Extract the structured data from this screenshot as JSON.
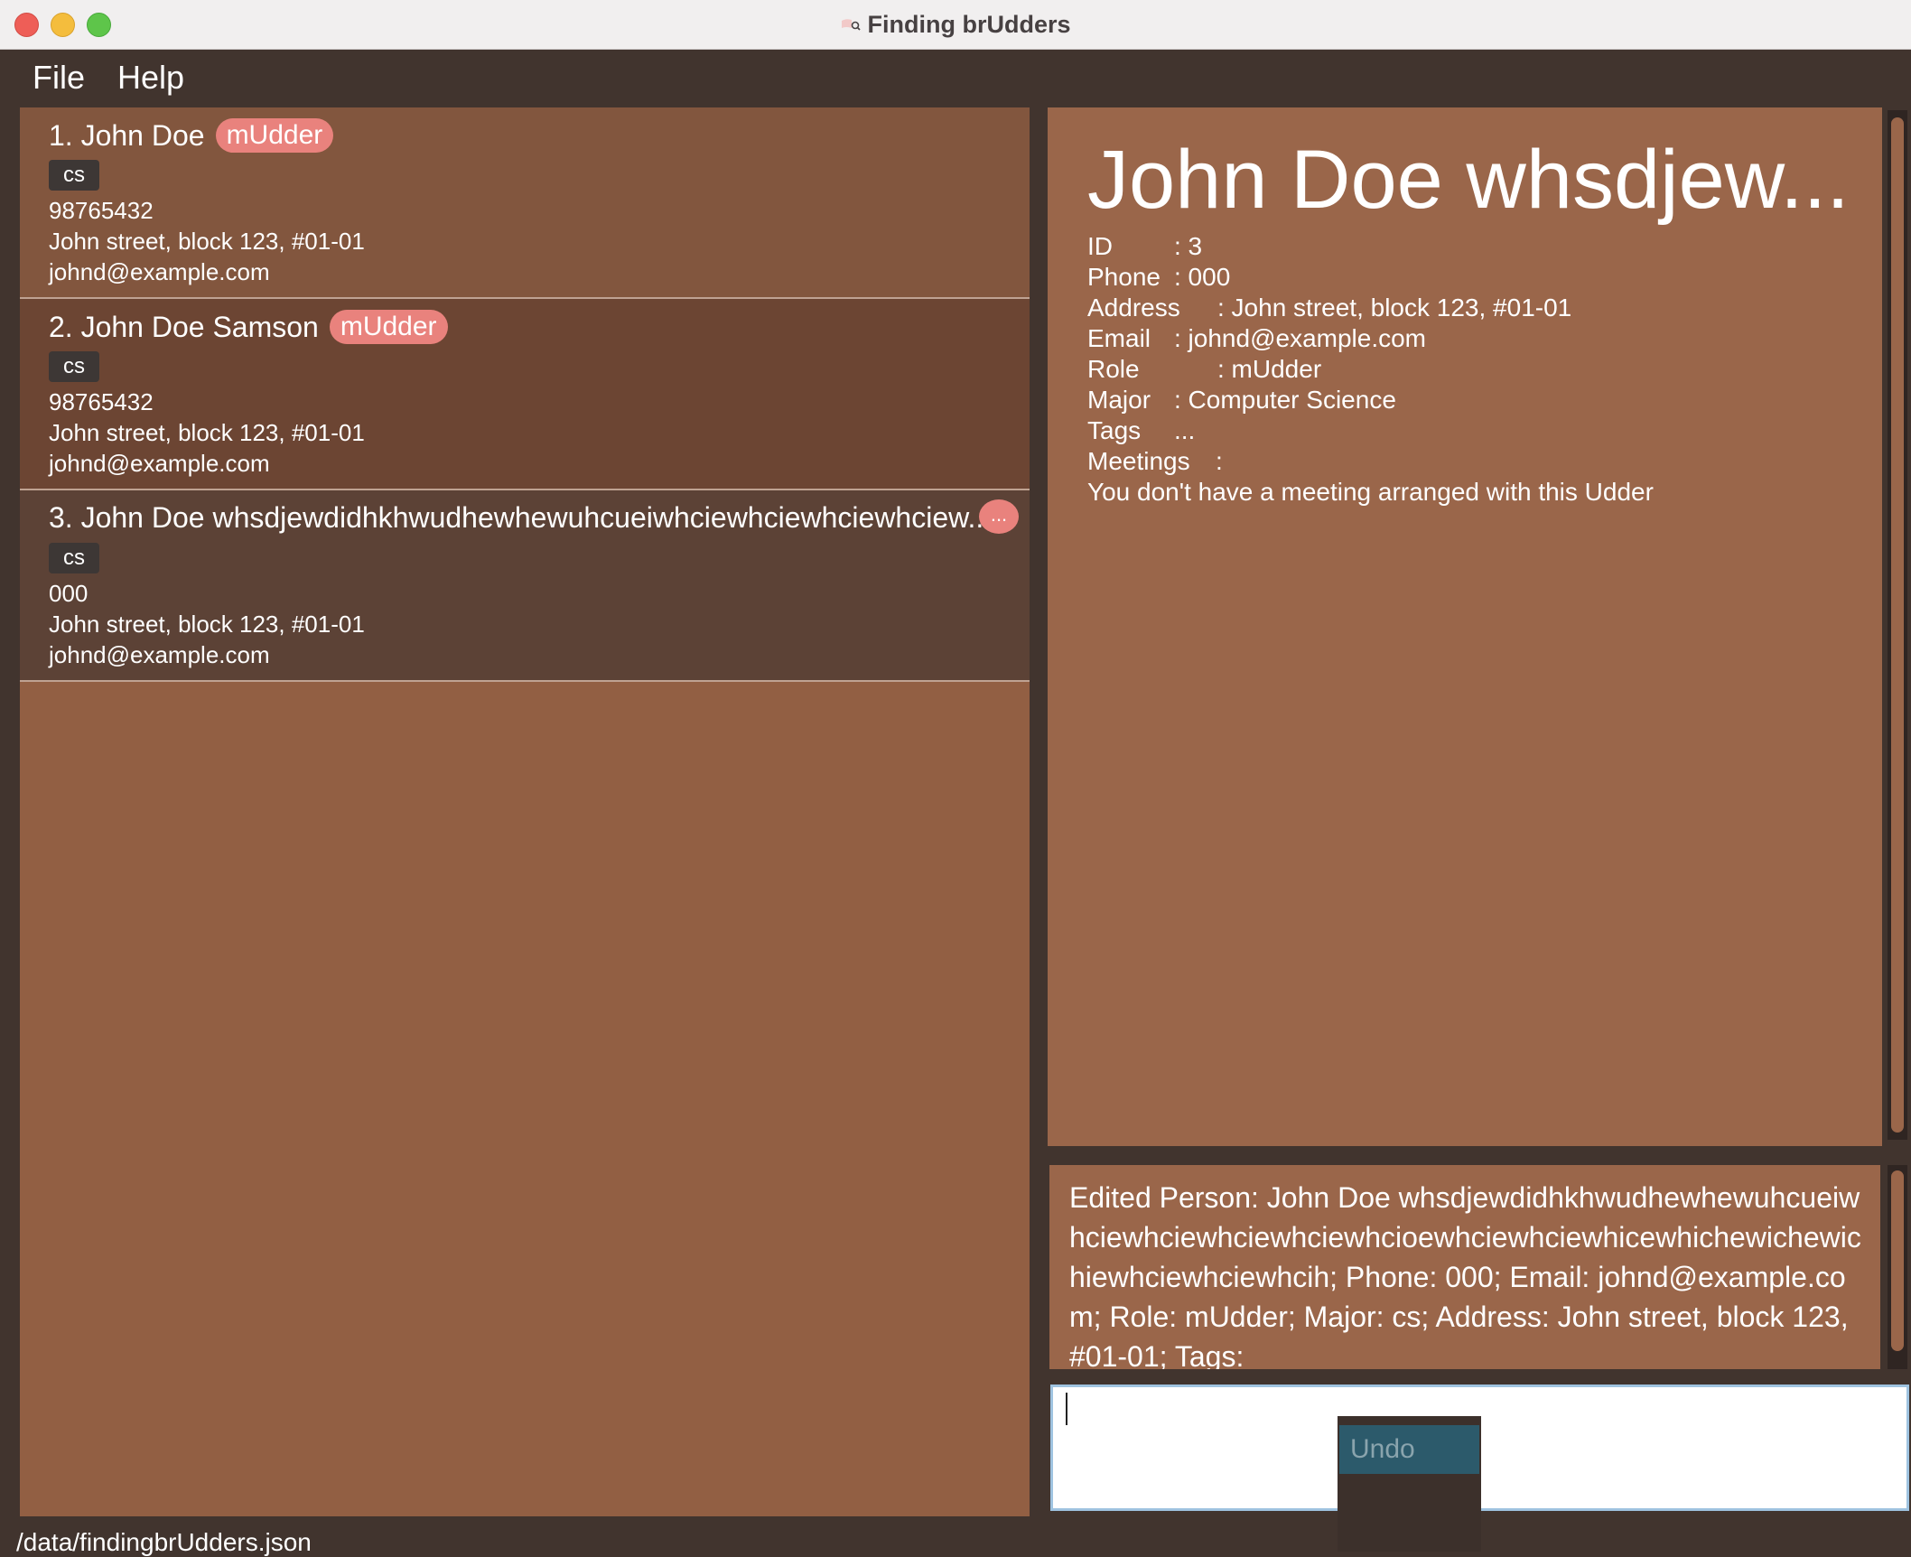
{
  "window": {
    "title": "Finding brUdders"
  },
  "menu": {
    "file": "File",
    "help": "Help"
  },
  "persons": [
    {
      "index_name": "1. John Doe",
      "role": "mUdder",
      "tag": "cs",
      "phone": "98765432",
      "address": "John street, block 123, #01-01",
      "email": "johnd@example.com",
      "bg": "#82563e"
    },
    {
      "index_name": "2. John Doe Samson",
      "role": "mUdder",
      "tag": "cs",
      "phone": "98765432",
      "address": "John street, block 123, #01-01",
      "email": "johnd@example.com",
      "bg": "#6c4533"
    },
    {
      "index_name": "3. John Doe whsdjewdidhkhwudhewhewuhcueiwhciewhciewhciewhciew...",
      "role": "...",
      "tag": "cs",
      "phone": "000",
      "address": "John street, block 123, #01-01",
      "email": "johnd@example.com",
      "bg": "#5c4236"
    }
  ],
  "detail": {
    "name": "John Doe whsdjew...",
    "id_label": "ID",
    "id_value": ": 3",
    "phone_label": "Phone",
    "phone_value": ": 000",
    "address_label": "Address",
    "address_value": ": John street, block 123, #01-01",
    "email_label": "Email",
    "email_value": ": johnd@example.com",
    "role_label": "Role",
    "role_value": ": mUdder",
    "major_label": "Major",
    "major_value": ": Computer Science",
    "tags_label": "Tags",
    "tags_value": "...",
    "meetings_label": "Meetings",
    "meetings_value": ":",
    "meeting_note": "You don't have a meeting arranged with this Udder"
  },
  "result": {
    "text": "Edited Person: John Doe whsdjewdidhkhwudhewhewuhcueiwhciewhciewhciewhciewhcioewhciewhciewhicewhichewichewichiewhciewhciewhcih; Phone: 000; Email: johnd@example.com; Role: mUdder; Major: cs; Address: John street, block 123, #01-01; Tags:"
  },
  "command": {
    "value": ""
  },
  "context_menu": {
    "undo": "Undo"
  },
  "status": {
    "path": "/data/findingbrUdders.json"
  },
  "colors": {
    "background": "#41342e",
    "list_panel": "#925f43",
    "detail_panel": "#9a664a",
    "role_badge": "#e9827d",
    "tag": "#3d3735"
  }
}
